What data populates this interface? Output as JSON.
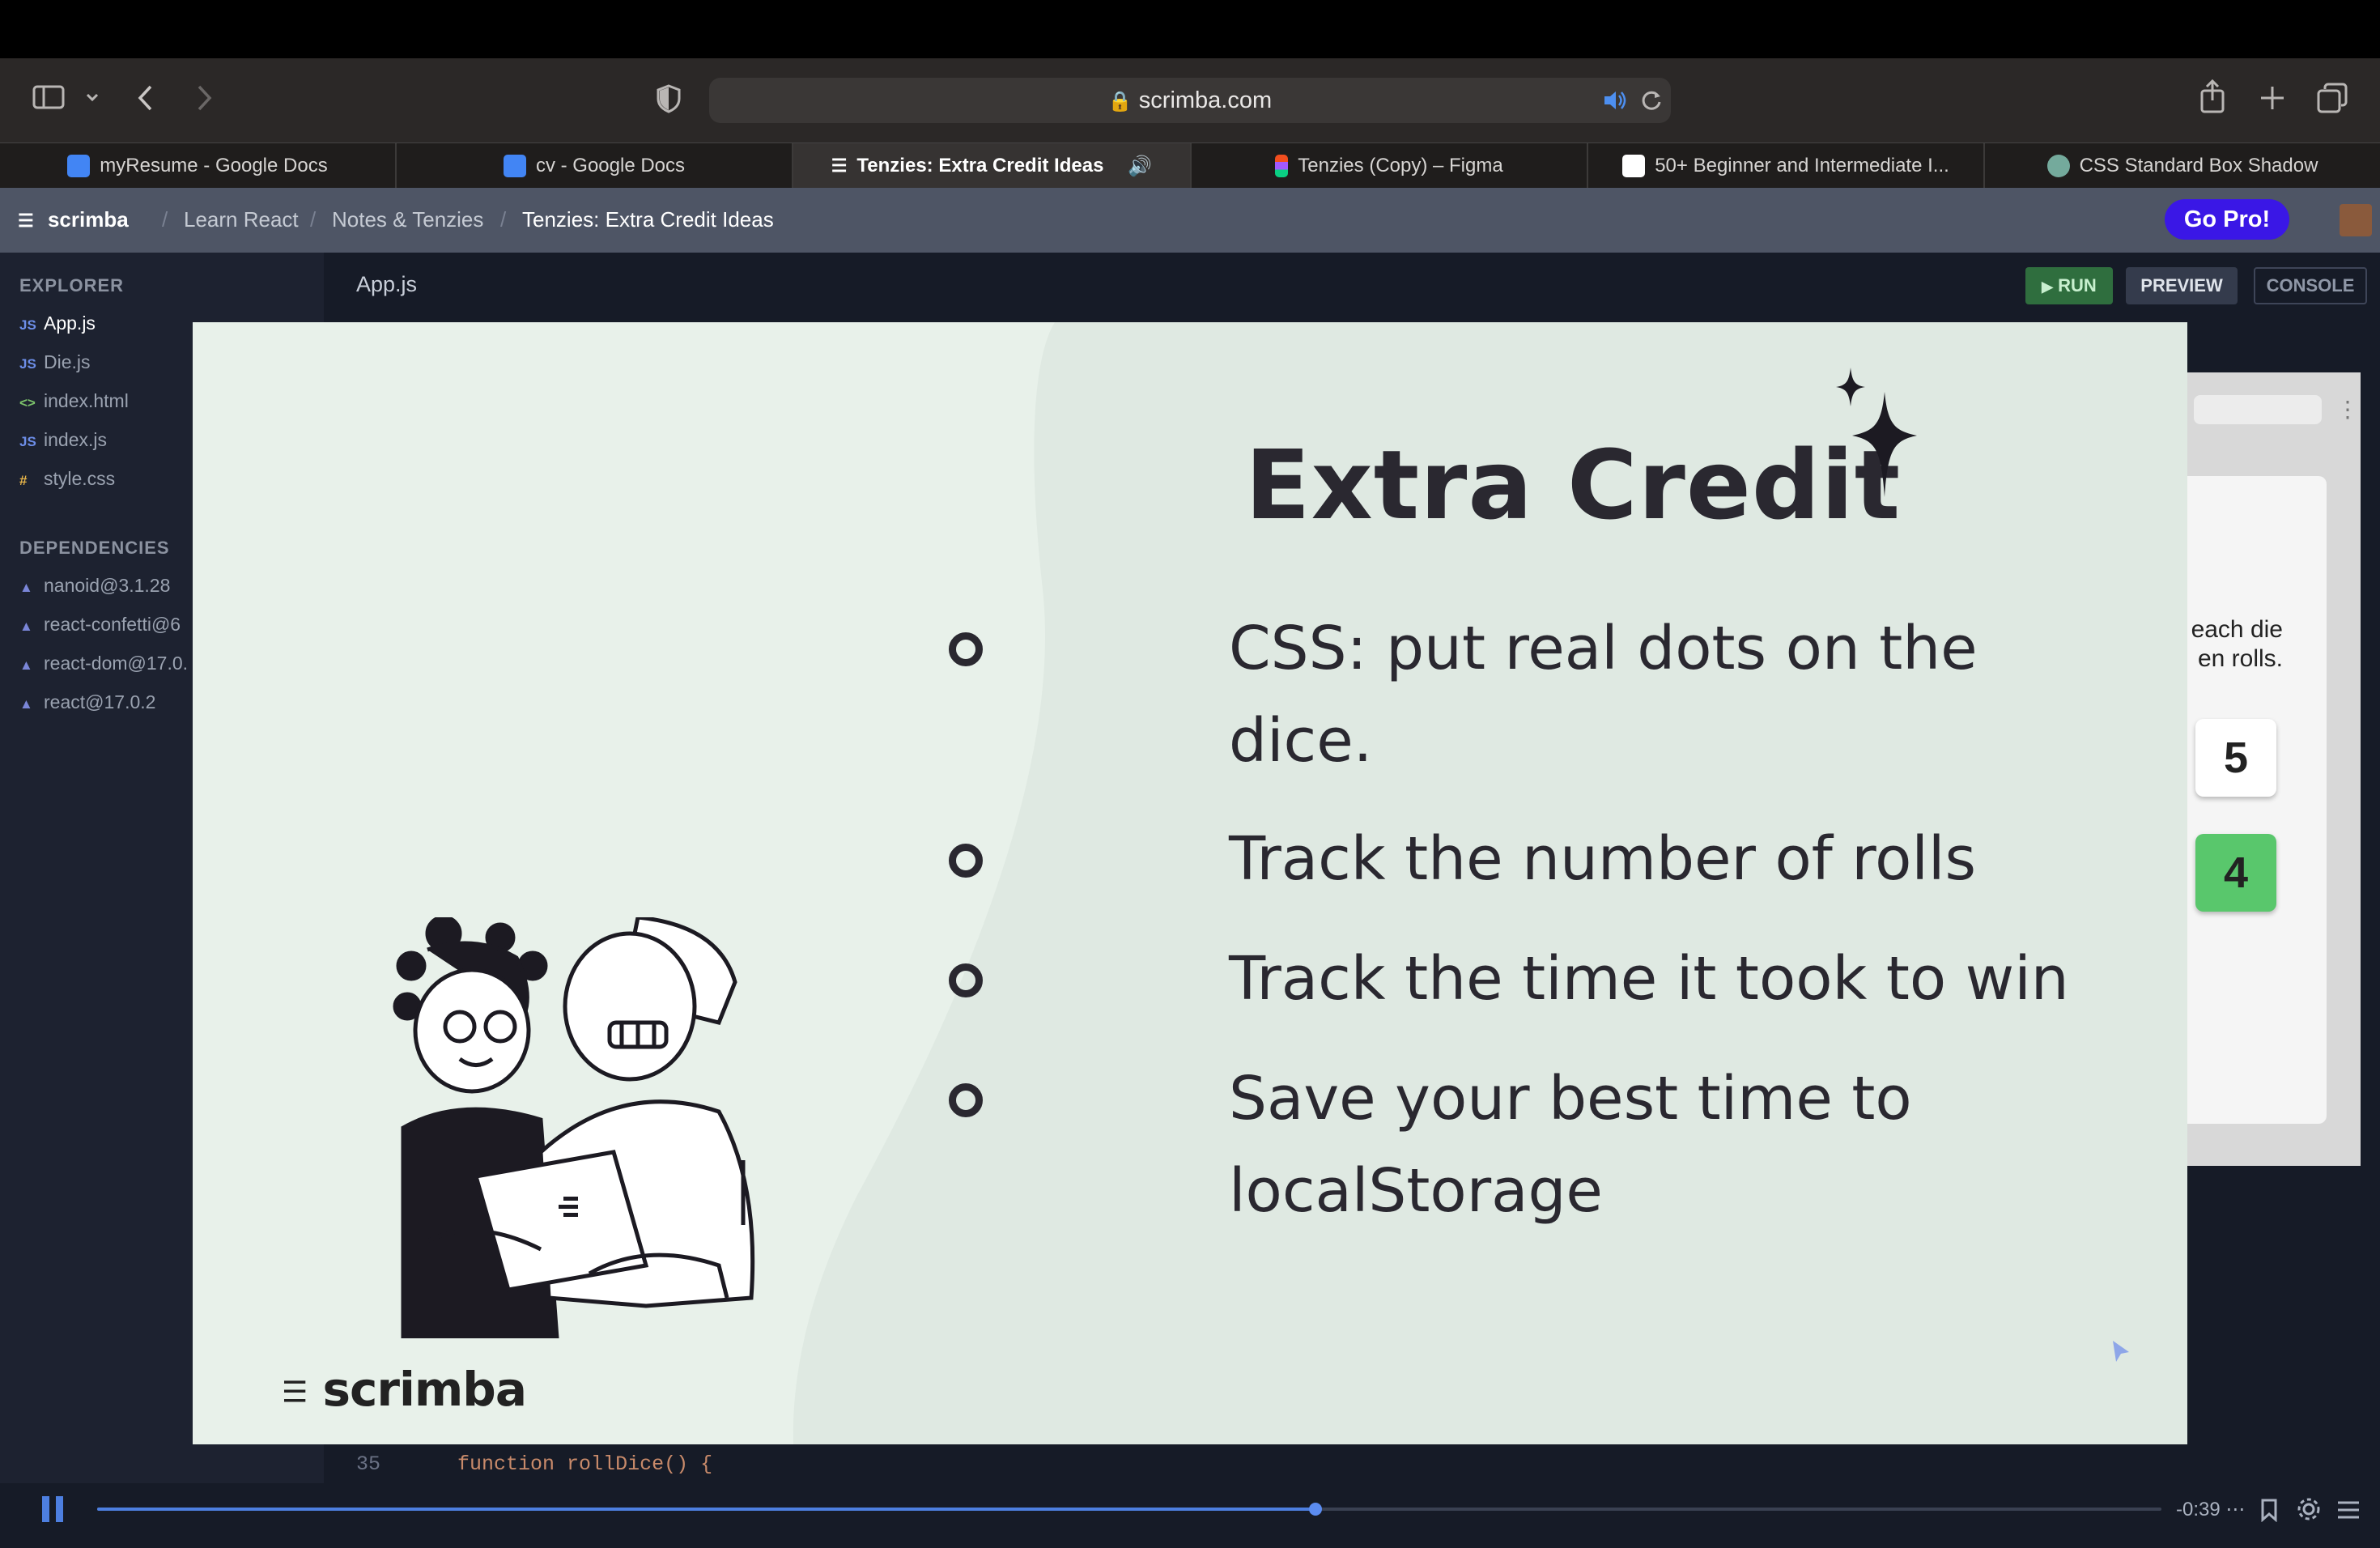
{
  "browser": {
    "url": "scrimba.com",
    "tabs": [
      {
        "label": "myResume - Google Docs",
        "color": "#4285f4"
      },
      {
        "label": "cv - Google Docs",
        "color": "#4285f4"
      },
      {
        "label": "Tenzies: Extra Credit Ideas",
        "color": "#ffffff"
      },
      {
        "label": "Tenzies (Copy) – Figma",
        "color": "#f24e1e"
      },
      {
        "label": "50+ Beginner and Intermediate I...",
        "color": "#ffffff"
      },
      {
        "label": "CSS Standard Box Shadow",
        "color": "#74aa9c"
      }
    ]
  },
  "header": {
    "brand": "scrimba",
    "crumbs": [
      "Learn React",
      "Notes & Tenzies",
      "Tenzies: Extra Credit Ideas"
    ],
    "go_pro": "Go Pro!"
  },
  "sidebar": {
    "explorer_title": "EXPLORER",
    "files": [
      {
        "icon": "JS",
        "name": "App.js"
      },
      {
        "icon": "JS",
        "name": "Die.js"
      },
      {
        "icon": "<>",
        "name": "index.html"
      },
      {
        "icon": "JS",
        "name": "index.js"
      },
      {
        "icon": "#",
        "name": "style.css"
      }
    ],
    "deps_title": "DEPENDENCIES",
    "deps": [
      "nanoid@3.1.28",
      "react-confetti@6",
      "react-dom@17.0.",
      "react@17.0.2"
    ]
  },
  "editor": {
    "tab": "App.js",
    "run": "RUN",
    "preview": "PREVIEW",
    "console": "CONSOLE",
    "line_no": "35",
    "code_line": "function rollDice() {"
  },
  "preview": {
    "text_line1": "each die",
    "text_line2": "en rolls.",
    "die1": "5",
    "die2": "4"
  },
  "slide": {
    "title": "Extra Credit",
    "bullets": [
      "CSS: put real dots on the dice.",
      "Track the number of rolls",
      "Track the time it took to win",
      "Save your best time to localStorage"
    ],
    "brand": "scrimba"
  },
  "player": {
    "time": "-0:39",
    "progress": 0.59
  }
}
